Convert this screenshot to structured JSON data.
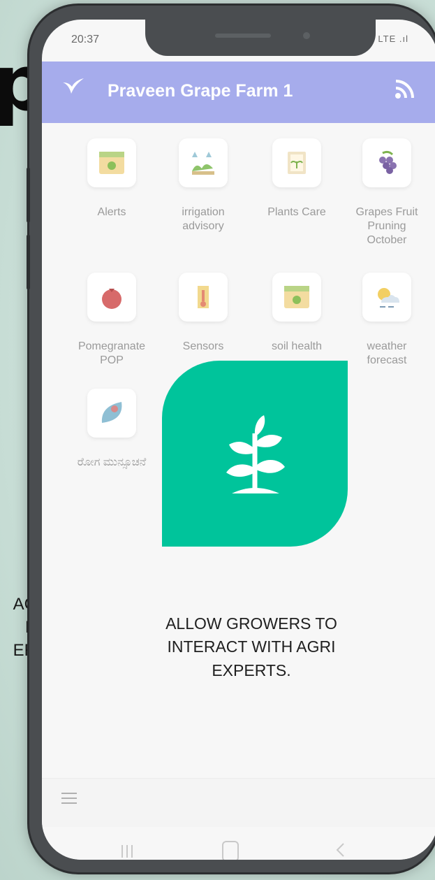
{
  "background": {
    "headline_fragment": "p",
    "side_text_lines": [
      "ACK",
      "BY",
      "ERS"
    ]
  },
  "status_bar": {
    "time": "20:37",
    "indicators": "Vo LTE .ıl Vo LTE .ıl"
  },
  "app_bar": {
    "title": "Praveen Grape Farm 1",
    "logo_icon": "leaf-bird-logo",
    "feed_icon": "rss-feed-icon"
  },
  "tiles": [
    {
      "label": "Alerts",
      "icon": "calendar-gear-icon"
    },
    {
      "label": "irrigation advisory",
      "icon": "sprinkler-plants-icon"
    },
    {
      "label": "Plants Care",
      "icon": "plant-frame-icon"
    },
    {
      "label": "Grapes Fruit Pruning October",
      "icon": "grapes-icon"
    },
    {
      "label": "Pomegranate POP",
      "icon": "pomegranate-icon"
    },
    {
      "label": "Sensors",
      "icon": "thermometer-icon"
    },
    {
      "label": "soil health",
      "icon": "calendar-gear-icon"
    },
    {
      "label": "weather forecast",
      "icon": "sun-cloud-icon"
    },
    {
      "label": "ರೋಗ ಮುನ್ಸೂಚನೆ",
      "icon": "leaf-disease-icon"
    }
  ],
  "feature_card": {
    "icon": "seedling-icon",
    "color": "#00c49b"
  },
  "caption": {
    "line1": "ALLOW GROWERS TO",
    "line2": "INTERACT WITH AGRI",
    "line3": "EXPERTS."
  },
  "colors": {
    "app_bar": "#a6acec",
    "accent_green": "#00c49b"
  }
}
